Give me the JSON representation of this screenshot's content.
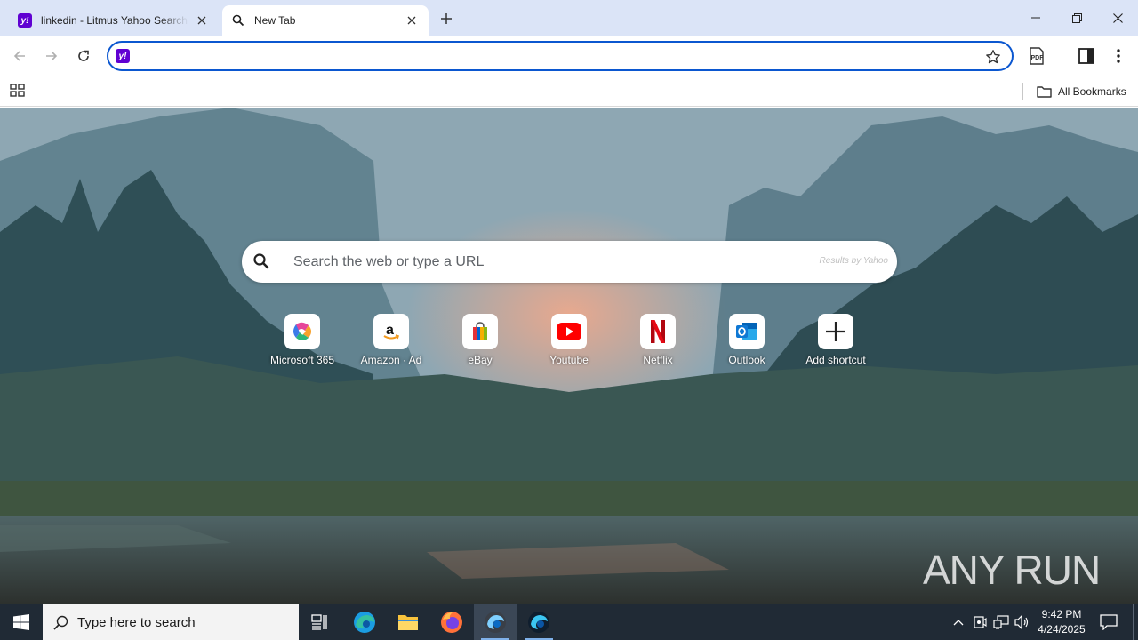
{
  "browser": {
    "tabs": [
      {
        "title": "linkedin - Litmus Yahoo Search",
        "favicon": "yahoo-icon",
        "active": false
      },
      {
        "title": "New Tab",
        "favicon": "search-icon",
        "active": true
      }
    ],
    "address_bar": {
      "value": "",
      "favicon": "yahoo-icon"
    },
    "bookmarks": {
      "all_bookmarks_label": "All Bookmarks"
    }
  },
  "newtab": {
    "search": {
      "placeholder": "Search the web or type a URL",
      "provider_note": "Results by Yahoo"
    },
    "shortcuts": [
      {
        "label": "Microsoft 365",
        "icon": "microsoft-365-icon"
      },
      {
        "label": "Amazon · Ad",
        "icon": "amazon-icon"
      },
      {
        "label": "eBay",
        "icon": "ebay-icon"
      },
      {
        "label": "Youtube",
        "icon": "youtube-icon"
      },
      {
        "label": "Netflix",
        "icon": "netflix-icon"
      },
      {
        "label": "Outlook",
        "icon": "outlook-icon"
      },
      {
        "label": "Add shortcut",
        "icon": "plus-icon"
      }
    ],
    "watermark": "ANY RUN"
  },
  "taskbar": {
    "search_placeholder": "Type here to search",
    "apps": [
      "task-view-icon",
      "edge-icon",
      "file-explorer-icon",
      "firefox-icon",
      "edge-dev-icon",
      "edge-beta-icon"
    ],
    "clock": {
      "time": "9:42 PM",
      "date": "4/24/2025"
    }
  },
  "colors": {
    "accent": "#0b57d0",
    "yahoo": "#6001d2",
    "tabstrip": "#dbe4f7",
    "taskbar": "#202a35"
  }
}
